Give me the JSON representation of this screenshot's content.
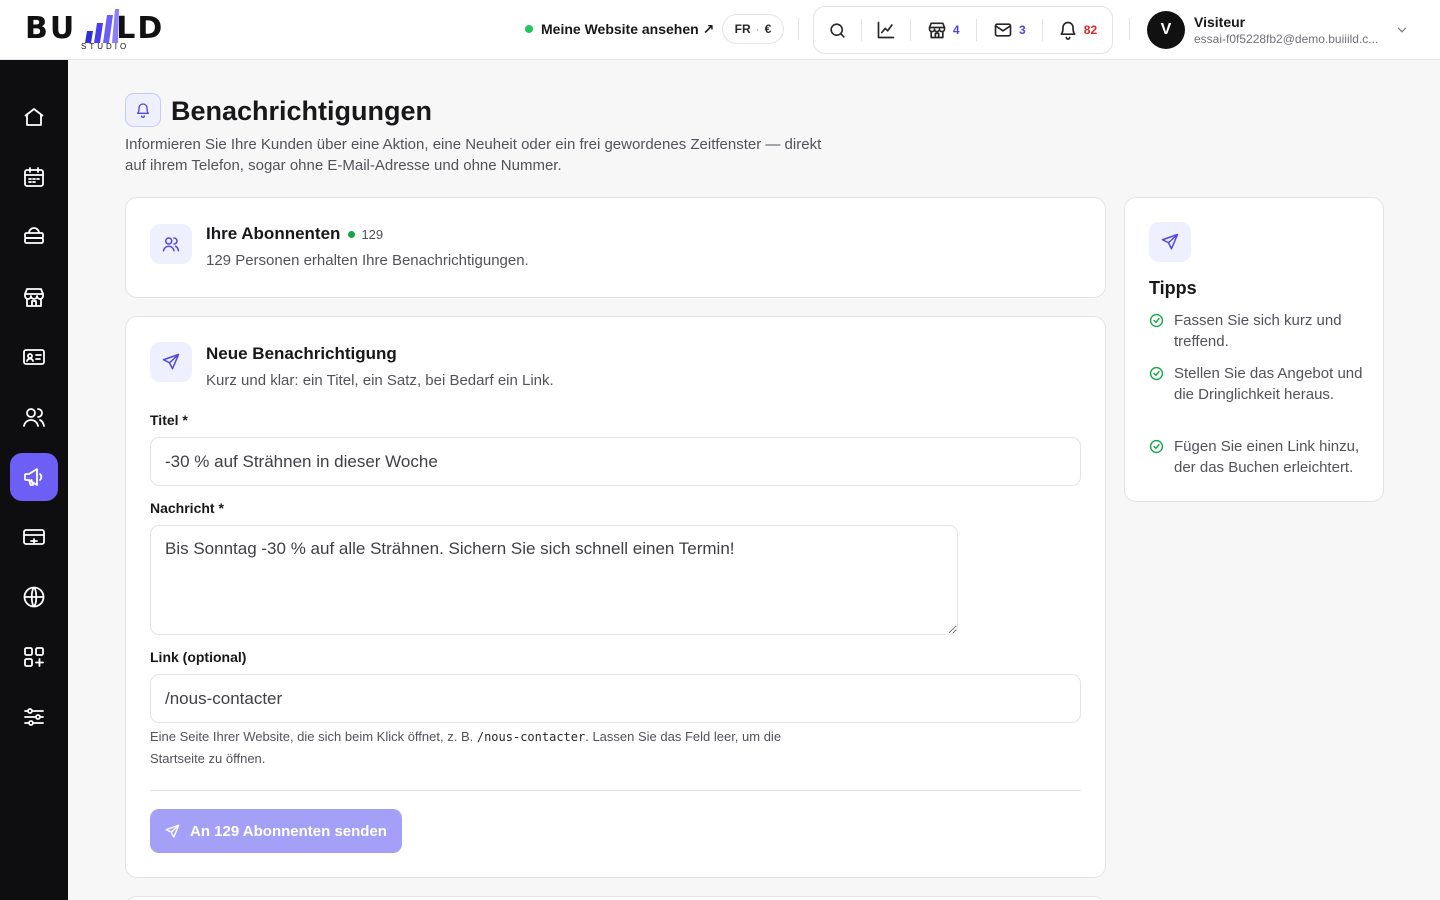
{
  "brand": {
    "logo_left": "BU",
    "logo_right": "LD",
    "logo_sub": "STUDIO"
  },
  "header": {
    "site_link": "Meine Website ansehen ↗",
    "lang": "FR",
    "currency": "€",
    "badges": {
      "shop": "4",
      "mail": "3",
      "bell": "82"
    }
  },
  "user": {
    "initial": "V",
    "name": "Visiteur",
    "email": "essai-f0f5228fb2@demo.buiiild.c..."
  },
  "sidebar": {
    "items": [
      "home-icon",
      "calendar-icon",
      "services-icon",
      "store-icon",
      "id-card-icon",
      "users-icon",
      "megaphone-icon",
      "payment-icon",
      "globe-icon",
      "apps-icon",
      "settings-sliders-icon"
    ],
    "active": "megaphone-icon"
  },
  "page": {
    "title": "Benachrichtigungen",
    "subtitle": "Informieren Sie Ihre Kunden über eine Aktion, eine Neuheit oder ein frei gewordenes Zeitfenster — direkt auf ihrem Telefon, sogar ohne E-Mail-Adresse und ohne Nummer."
  },
  "subscribers": {
    "title": "Ihre Abonnenten",
    "count": "129",
    "text": "129 Personen erhalten Ihre Benachrichtigungen."
  },
  "new_notification": {
    "title": "Neue Benachrichtigung",
    "subtitle": "Kurz und klar: ein Titel, ein Satz, bei Bedarf ein Link.",
    "title_label": "Titel *",
    "title_value": "-30 % auf Strähnen in dieser Woche",
    "message_label": "Nachricht *",
    "message_value": "Bis Sonntag -30 % auf alle Strähnen. Sichern Sie sich schnell einen Termin!",
    "link_label": "Link (optional)",
    "link_value": "/nous-contacter",
    "help_pre": "Eine Seite Ihrer Website, die sich beim Klick öffnet, z. B. ",
    "help_code": "/nous-contacter",
    "help_post": ". Lassen Sie das Feld leer, um die Startseite zu öffnen.",
    "send_label": "An 129 Abonnenten senden"
  },
  "tips": {
    "title": "Tipps",
    "items": [
      "Fassen Sie sich kurz und treffend.",
      "Stellen Sie das Angebot und die Dringlichkeit heraus.",
      "Fügen Sie einen Link hinzu, der das Buchen erleichtert."
    ]
  },
  "colors": {
    "accent": "#6d5ef5",
    "accent_light": "#eef0ff",
    "sidebar_bg": "#0e0e10",
    "success": "#16a34a",
    "danger": "#dc2626"
  }
}
